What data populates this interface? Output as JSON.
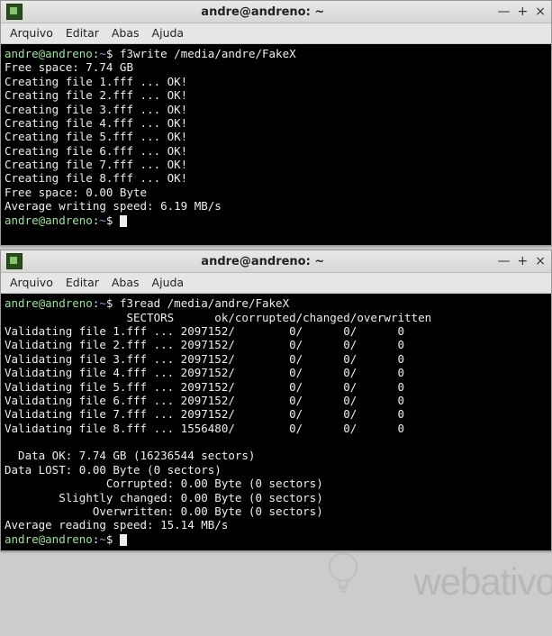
{
  "windows": {
    "w1": {
      "title": "andre@andreno: ~",
      "menu": [
        "Arquivo",
        "Editar",
        "Abas",
        "Ajuda"
      ],
      "buttons": {
        "min": "—",
        "max": "+",
        "close": "×"
      },
      "prompt_user": "andre@andreno",
      "prompt_sep": ":",
      "prompt_path": "~",
      "prompt_sym": "$ ",
      "command": "f3write /media/andre/FakeX",
      "line_free1": "Free space: 7.74 GB",
      "create": [
        "Creating file 1.fff ... OK!",
        "Creating file 2.fff ... OK!",
        "Creating file 3.fff ... OK!",
        "Creating file 4.fff ... OK!",
        "Creating file 5.fff ... OK!",
        "Creating file 6.fff ... OK!",
        "Creating file 7.fff ... OK!",
        "Creating file 8.fff ... OK!"
      ],
      "line_free2": "Free space: 0.00 Byte",
      "line_avg": "Average writing speed: 6.19 MB/s"
    },
    "w2": {
      "title": "andre@andreno: ~",
      "menu": [
        "Arquivo",
        "Editar",
        "Abas",
        "Ajuda"
      ],
      "buttons": {
        "min": "—",
        "max": "+",
        "close": "×"
      },
      "prompt_user": "andre@andreno",
      "prompt_sep": ":",
      "prompt_path": "~",
      "prompt_sym": "$ ",
      "command": "f3read /media/andre/FakeX",
      "header": "                  SECTORS      ok/corrupted/changed/overwritten",
      "rows": [
        "Validating file 1.fff ... 2097152/        0/      0/      0",
        "Validating file 2.fff ... 2097152/        0/      0/      0",
        "Validating file 3.fff ... 2097152/        0/      0/      0",
        "Validating file 4.fff ... 2097152/        0/      0/      0",
        "Validating file 5.fff ... 2097152/        0/      0/      0",
        "Validating file 6.fff ... 2097152/        0/      0/      0",
        "Validating file 7.fff ... 2097152/        0/      0/      0",
        "Validating file 8.fff ... 1556480/        0/      0/      0"
      ],
      "blank": "",
      "summary": [
        "  Data OK: 7.74 GB (16236544 sectors)",
        "Data LOST: 0.00 Byte (0 sectors)",
        "\t       Corrupted: 0.00 Byte (0 sectors)",
        "\tSlightly changed: 0.00 Byte (0 sectors)",
        "\t     Overwritten: 0.00 Byte (0 sectors)"
      ],
      "avg": "Average reading speed: 15.14 MB/s"
    }
  },
  "watermark": "webativo"
}
